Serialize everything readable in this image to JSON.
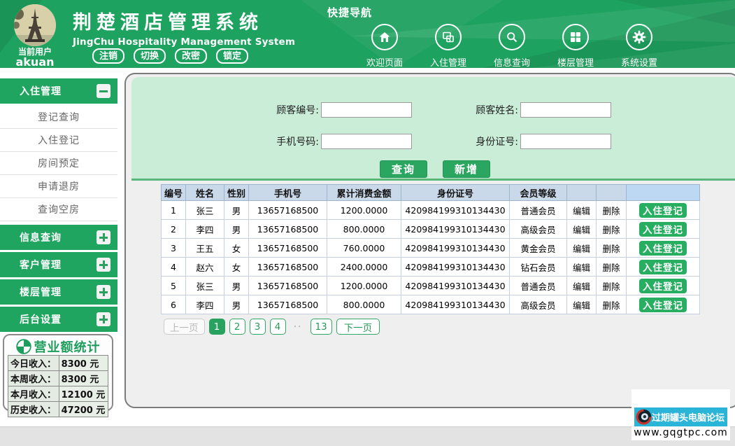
{
  "colors": {
    "header_green": "#1ea25f",
    "accent_green": "#27a35f",
    "form_bg": "#c9edd7",
    "table_header_bg": "#c9d9ea",
    "banner_cyan": "#2ab4d8"
  },
  "header": {
    "user_label": "当前用户",
    "username": "akuan",
    "title": "荆楚酒店管理系统",
    "subtitle": "JingChu Hospitality Management System",
    "session_buttons": [
      "注销",
      "切换",
      "改密",
      "锁定"
    ],
    "quick_nav_label": "快捷导航",
    "nav_items": [
      {
        "label": "欢迎页面",
        "icon": "home-icon"
      },
      {
        "label": "入住管理",
        "icon": "checkin-icon"
      },
      {
        "label": "信息查询",
        "icon": "search-icon"
      },
      {
        "label": "楼层管理",
        "icon": "floor-grid-icon"
      },
      {
        "label": "系统设置",
        "icon": "gear-icon"
      }
    ]
  },
  "sidebar": {
    "sections": [
      {
        "label": "入住管理",
        "state": "expanded",
        "items": [
          "登记查询",
          "入住登记",
          "房间预定",
          "申请退房",
          "查询空房"
        ]
      },
      {
        "label": "信息查询",
        "state": "collapsed"
      },
      {
        "label": "客户管理",
        "state": "collapsed"
      },
      {
        "label": "楼层管理",
        "state": "collapsed"
      },
      {
        "label": "后台设置",
        "state": "collapsed"
      }
    ],
    "stats": {
      "title": "营业额统计",
      "rows": [
        {
          "label": "今日收入：",
          "value": "8300 元"
        },
        {
          "label": "本周收入：",
          "value": "8300 元"
        },
        {
          "label": "本月收入：",
          "value": "12100 元"
        },
        {
          "label": "历史收入：",
          "value": "47200 元"
        }
      ]
    }
  },
  "search_form": {
    "fields": [
      {
        "label": "顾客编号:",
        "value": ""
      },
      {
        "label": "顾客姓名:",
        "value": ""
      },
      {
        "label": "手机号码:",
        "value": ""
      },
      {
        "label": "身份证号:",
        "value": ""
      }
    ],
    "query_button": "查询",
    "add_button": "新增"
  },
  "table": {
    "headers": [
      "编号",
      "姓名",
      "性别",
      "手机号",
      "累计消费金额",
      "身份证号",
      "会员等级",
      "",
      "",
      ""
    ],
    "edit_label": "编辑",
    "delete_label": "删除",
    "checkin_label": "入住登记",
    "rows": [
      {
        "id": "1",
        "name": "张三",
        "gender": "男",
        "phone": "13657168500",
        "amount": "1200.0000",
        "id_card": "420984199310134430",
        "level": "普通会员"
      },
      {
        "id": "2",
        "name": "李四",
        "gender": "男",
        "phone": "13657168500",
        "amount": "800.0000",
        "id_card": "420984199310134430",
        "level": "高级会员"
      },
      {
        "id": "3",
        "name": "王五",
        "gender": "女",
        "phone": "13657168500",
        "amount": "760.0000",
        "id_card": "420984199310134430",
        "level": "黄金会员"
      },
      {
        "id": "4",
        "name": "赵六",
        "gender": "女",
        "phone": "13657168500",
        "amount": "2400.0000",
        "id_card": "420984199310134430",
        "level": "钻石会员"
      },
      {
        "id": "5",
        "name": "张三",
        "gender": "男",
        "phone": "13657168500",
        "amount": "1200.0000",
        "id_card": "420984199310134430",
        "level": "普通会员"
      },
      {
        "id": "6",
        "name": "李四",
        "gender": "男",
        "phone": "13657168500",
        "amount": "800.0000",
        "id_card": "420984199310134430",
        "level": "高级会员"
      }
    ]
  },
  "pagination": {
    "prev": "上一页",
    "pages": [
      "1",
      "2",
      "3",
      "4"
    ],
    "active_page": "1",
    "gap": "··",
    "last_page": "13",
    "next": "下一页"
  },
  "watermark": {
    "banner": "过期罐头电脑论坛",
    "url": "www.gqgtpc.com"
  }
}
